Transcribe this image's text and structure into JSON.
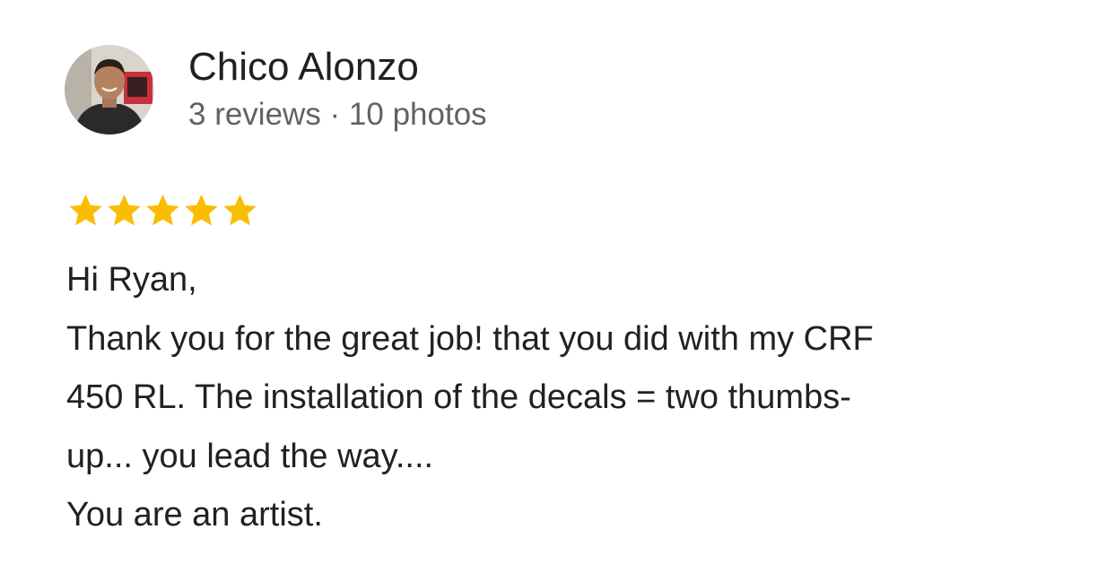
{
  "reviewer": {
    "name": "Chico Alonzo",
    "meta": "3 reviews · 10 photos",
    "avatar_icon": "user-photo-avatar"
  },
  "rating": {
    "value": 5,
    "max": 5,
    "star_icon": "star-icon",
    "star_color": "#fbbc04"
  },
  "review": {
    "lines": [
      "Hi Ryan,",
      "Thank you for the great job! that you did with my CRF",
      "450 RL.  The installation of the decals = two thumbs-",
      "up... you lead the way....",
      "You are an artist."
    ]
  },
  "colors": {
    "text_primary": "#202124",
    "text_secondary": "#5f6368",
    "background": "#ffffff"
  }
}
